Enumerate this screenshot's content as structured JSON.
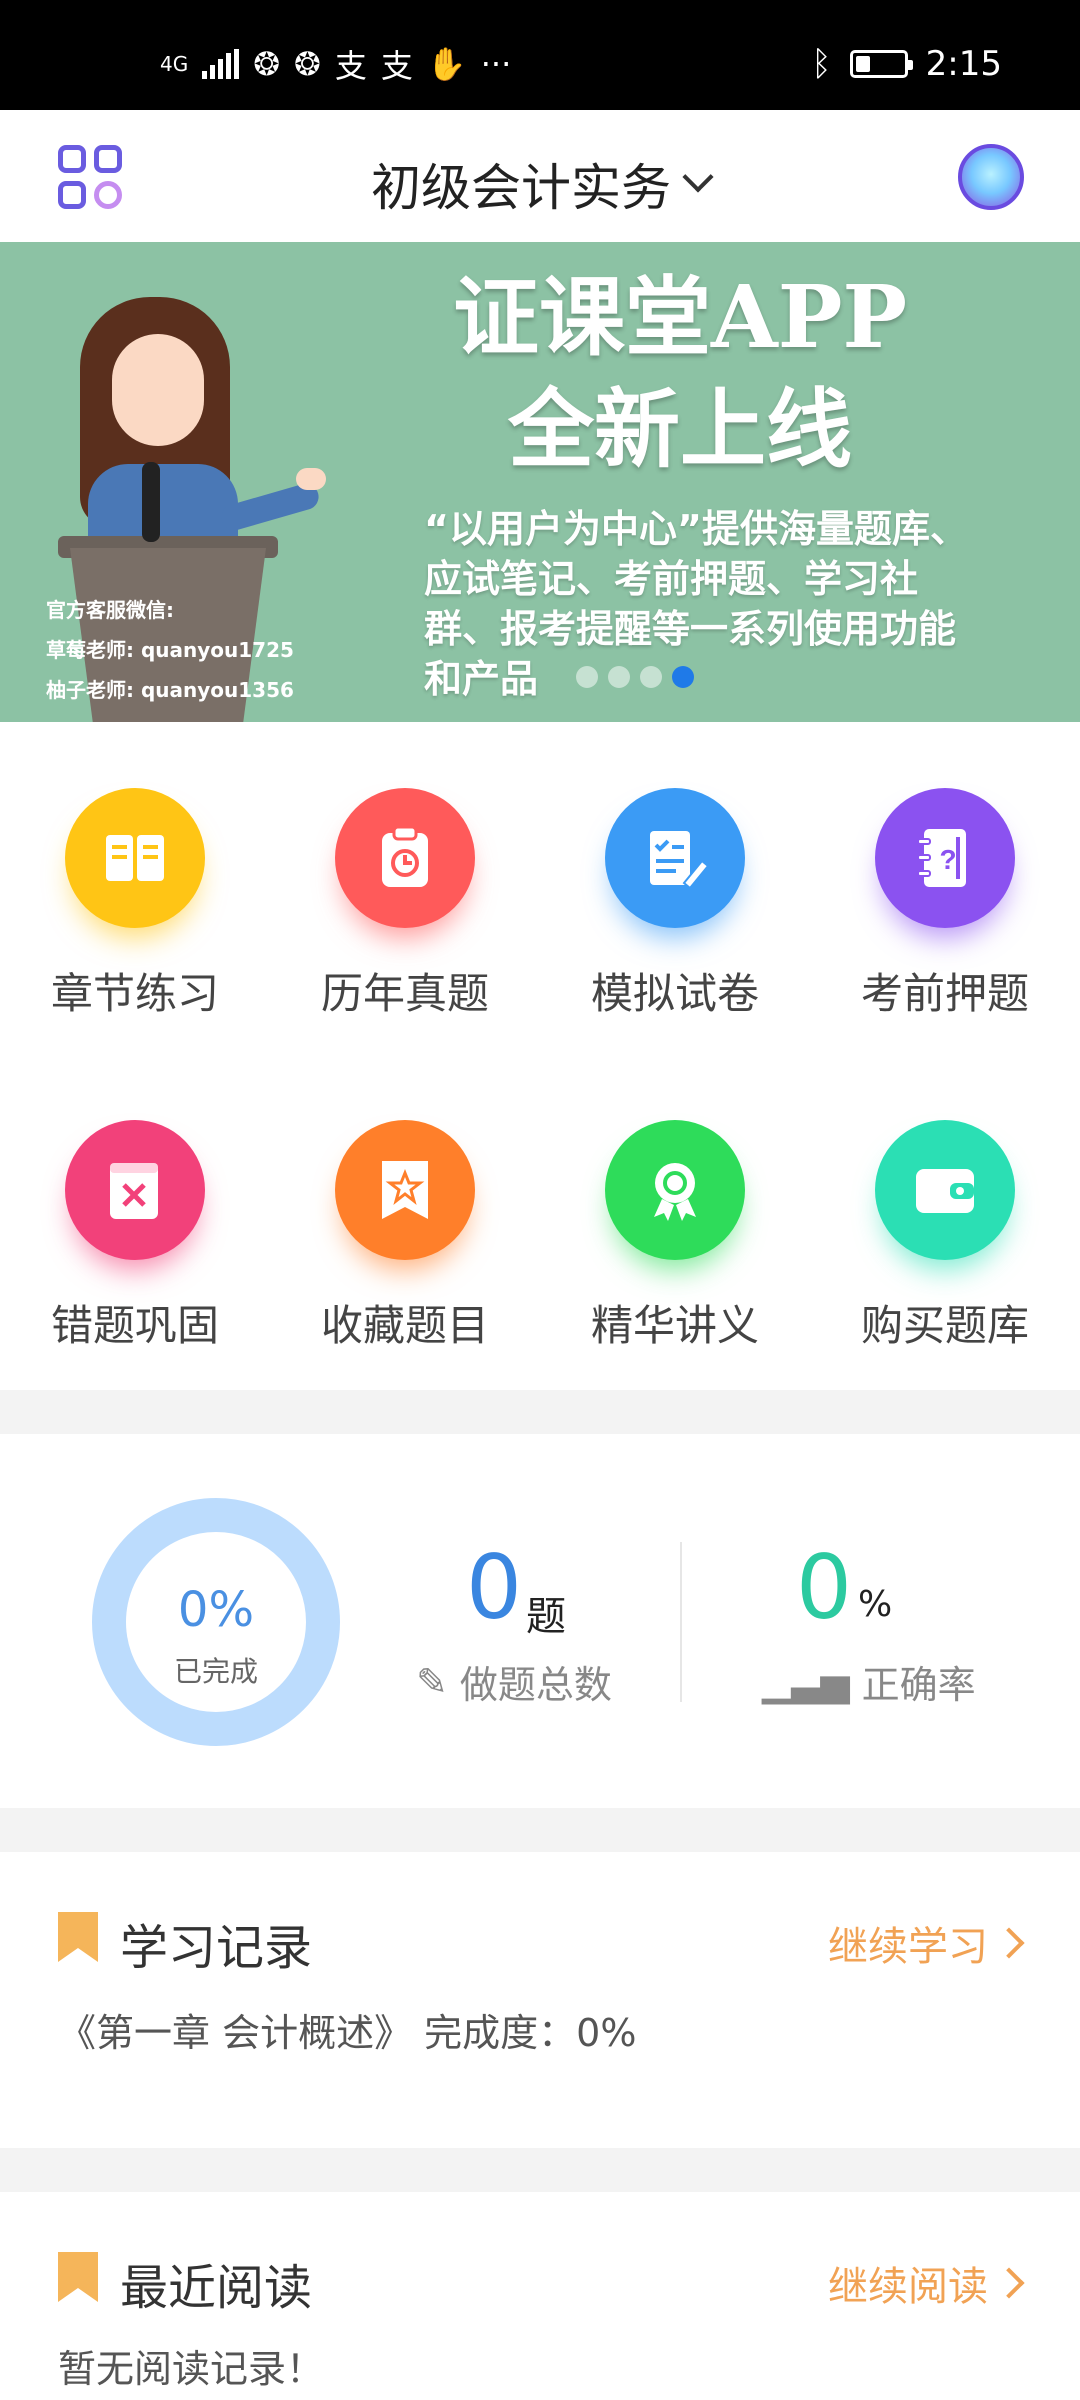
{
  "status_bar": {
    "network": "4G",
    "time": "2:15",
    "battery_level_pct": 30,
    "more": "···"
  },
  "header": {
    "title": "初级会计实务",
    "menu_icon": "grid-icon",
    "profile_icon": "avatar"
  },
  "banner": {
    "headline_1": "证课堂APP",
    "headline_2": "全新上线",
    "body": "“以用户为中心”提供海量题库、应试笔记、考前押题、学习社群、报考提醒等一系列使用功能和产品",
    "contact_title": "官方客服微信:",
    "contact_1": "草莓老师: quanyou1725",
    "contact_2": "柚子老师: quanyou1356",
    "active_slide": 3
  },
  "menu": [
    {
      "label": "章节练习",
      "icon": "book-icon",
      "color": "#ffc515"
    },
    {
      "label": "历年真题",
      "icon": "clipboard-icon",
      "color": "#ff5a5a"
    },
    {
      "label": "模拟试卷",
      "icon": "exam-paper-icon",
      "color": "#3b9bf5"
    },
    {
      "label": "考前押题",
      "icon": "notebook-question-icon",
      "color": "#8b52f0"
    },
    {
      "label": "错题巩固",
      "icon": "wrong-book-icon",
      "color": "#f2417a"
    },
    {
      "label": "收藏题目",
      "icon": "star-bookmark-icon",
      "color": "#ff7f2a"
    },
    {
      "label": "精华讲义",
      "icon": "award-icon",
      "color": "#2edc5a"
    },
    {
      "label": "购买题库",
      "icon": "wallet-icon",
      "color": "#2bdfb4"
    }
  ],
  "stats": {
    "completion": "0%",
    "completion_label": "已完成",
    "total_count": "0",
    "total_unit": "题",
    "total_label": "做题总数",
    "accuracy": "0",
    "accuracy_unit": "%",
    "accuracy_label": "正确率"
  },
  "study_record": {
    "title": "学习记录",
    "action": "继续学习",
    "text": "《第一章 会计概述》 完成度：0%"
  },
  "recent_reading": {
    "title": "最近阅读",
    "action": "继续阅读",
    "text": "暂无阅读记录！"
  },
  "colors": {
    "accent_orange": "#f1a254",
    "ring_blue": "#bcdcfd",
    "stat_blue": "#3a86e0",
    "stat_green": "#2ccaa0",
    "banner_bg": "#8cc2a4"
  }
}
